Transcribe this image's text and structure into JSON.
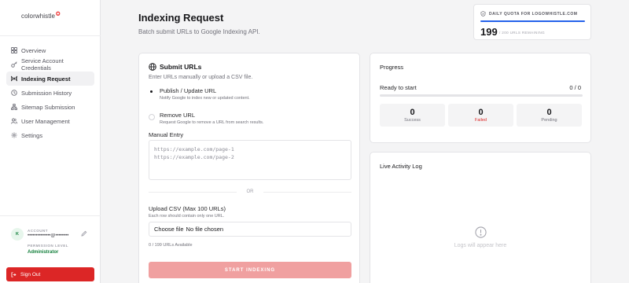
{
  "brand": {
    "logo_text": "colorwhistle"
  },
  "sidebar": {
    "items": [
      {
        "label": "Overview",
        "icon": "grid-icon",
        "active": false
      },
      {
        "label": "Service Account Credentials",
        "icon": "key-icon",
        "active": false
      },
      {
        "label": "Indexing Request",
        "icon": "broadcast-icon",
        "active": true
      },
      {
        "label": "Submission History",
        "icon": "history-icon",
        "active": false
      },
      {
        "label": "Sitemap Submission",
        "icon": "sitemap-icon",
        "active": false
      },
      {
        "label": "User Management",
        "icon": "users-icon",
        "active": false
      },
      {
        "label": "Settings",
        "icon": "gear-icon",
        "active": false
      }
    ],
    "account": {
      "label": "ACCOUNT",
      "avatar_initial": "K",
      "email": "••••••••••••••@••••••••",
      "permission_label": "PERMISSION LEVEL",
      "permission_value": "Administrator"
    },
    "sign_out_label": "Sign Out"
  },
  "header": {
    "title": "Indexing Request",
    "subtitle": "Batch submit URLs to Google Indexing API."
  },
  "quota": {
    "label": "DAILY QUOTA FOR LOGOWHISTLE.COM",
    "value": "199",
    "remaining_text": "/ 200 URLS REMAINING",
    "used_fraction": 1.0
  },
  "submit": {
    "title": "Submit URLs",
    "description": "Enter URLs manually or upload a CSV file.",
    "options": [
      {
        "title": "Publish / Update URL",
        "description": "Notify Google to index new or updated content.",
        "checked": true
      },
      {
        "title": "Remove URL",
        "description": "Request Google to remove a URL from search results.",
        "checked": false
      }
    ],
    "manual_entry_label": "Manual Entry",
    "manual_entry_placeholder": "https://example.com/page-1\nhttps://example.com/page-2",
    "or_text": "OR",
    "csv_label": "Upload CSV (Max 100 URLs)",
    "csv_hint": "Each row should contain only one URL.",
    "file_button_label": "Choose file",
    "file_status": "No file chosen",
    "available_text": "0 / 199 URLs Available",
    "start_button_label": "START INDEXING"
  },
  "progress": {
    "title": "Progress",
    "status": "Ready to start",
    "count": "0 / 0",
    "stats": [
      {
        "value": "0",
        "label": "Success"
      },
      {
        "value": "0",
        "label": "Failed"
      },
      {
        "value": "0",
        "label": "Pending"
      }
    ]
  },
  "log": {
    "title": "Live Activity Log",
    "empty_text": "Logs will appear here"
  },
  "colors": {
    "accent_blue": "#2563eb",
    "danger": "#dc2626",
    "success": "#15803d",
    "disabled_button": "#f0a0a0"
  }
}
